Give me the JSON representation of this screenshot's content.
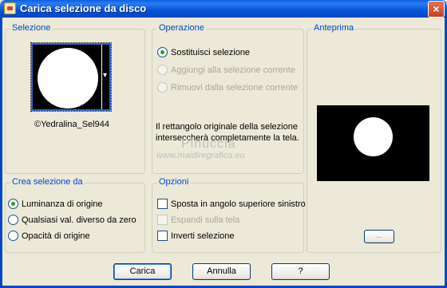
{
  "window": {
    "title": "Carica selezione da disco",
    "close_symbol": "×"
  },
  "selezione": {
    "label": "Selezione",
    "file_name": "©Yedralina_Sel944",
    "dropdown_symbol": "▾"
  },
  "operazione": {
    "label": "Operazione",
    "options": [
      {
        "label": "Sostituisci selezione",
        "checked": true,
        "enabled": true
      },
      {
        "label": "Aggiungi alla selezione corrente",
        "checked": false,
        "enabled": false
      },
      {
        "label": "Rimuovi dalla selezione corrente",
        "checked": false,
        "enabled": false
      }
    ],
    "info_text": "Il rettangolo originale della selezione interseccherà completamente la tela."
  },
  "anteprima": {
    "label": "Anteprima",
    "zoom_symbol": "..."
  },
  "crea": {
    "label": "Crea selezione da",
    "options": [
      {
        "label": "Luminanza di origine",
        "checked": true
      },
      {
        "label": "Qualsiasi val. diverso da zero",
        "checked": false
      },
      {
        "label": "Opacità di origine",
        "checked": false
      }
    ]
  },
  "opzioni": {
    "label": "Opzioni",
    "options": [
      {
        "label": "Sposta in angolo superiore sinistro",
        "checked": false,
        "enabled": true
      },
      {
        "label": "Espandi sulla tela",
        "checked": false,
        "enabled": false
      },
      {
        "label": "Inverti selezione",
        "checked": false,
        "enabled": true
      }
    ]
  },
  "watermark": {
    "name": "Pinuccia",
    "url": "www.maidiregrafica.eu"
  },
  "buttons": {
    "ok": "Carica",
    "cancel": "Annulla",
    "help": "?"
  }
}
